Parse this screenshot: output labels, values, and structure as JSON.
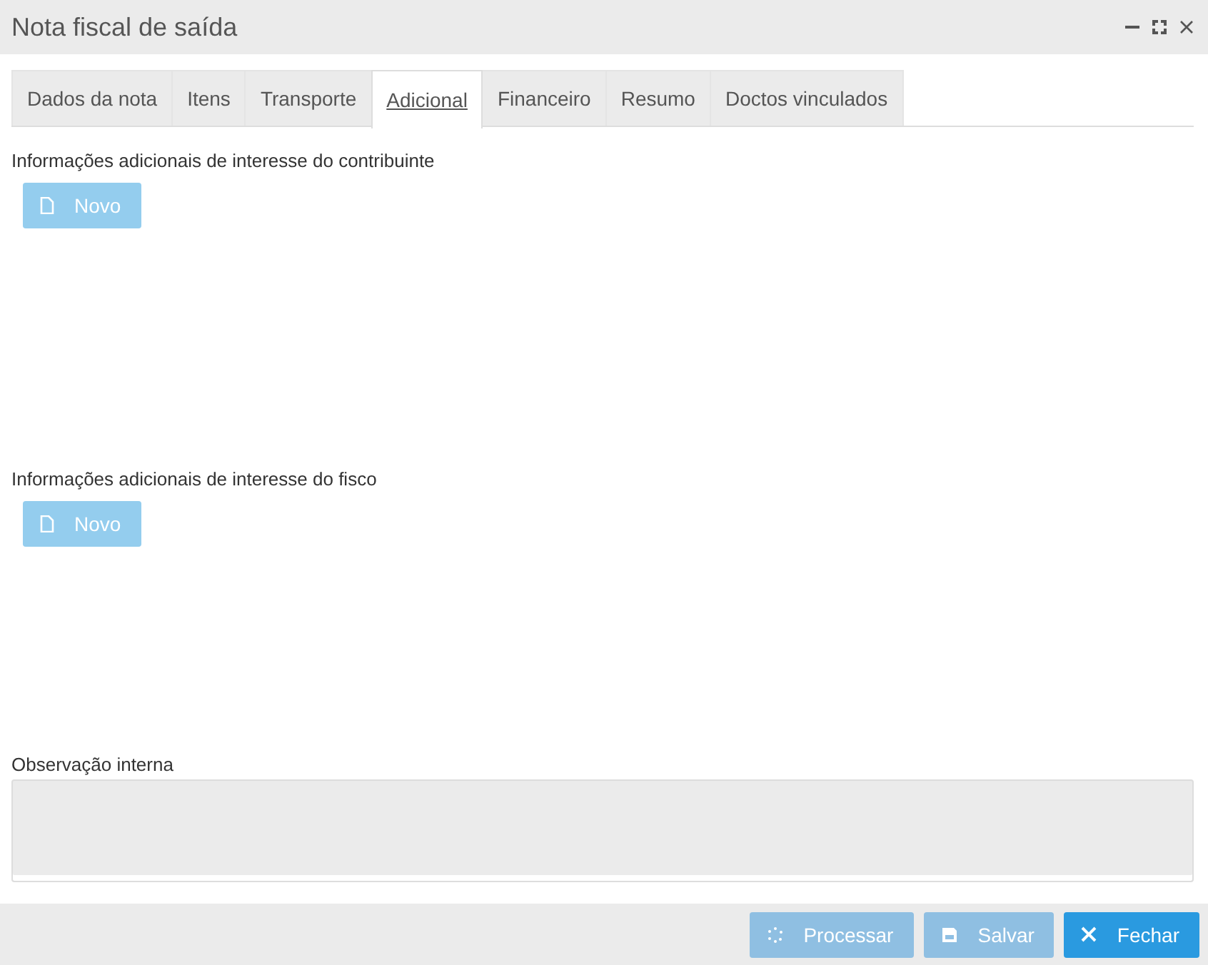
{
  "window": {
    "title": "Nota fiscal de saída"
  },
  "tabs": [
    {
      "label": "Dados da nota",
      "selected": false
    },
    {
      "label": "Itens",
      "selected": false
    },
    {
      "label": "Transporte",
      "selected": false
    },
    {
      "label": "Adicional",
      "selected": true
    },
    {
      "label": "Financeiro",
      "selected": false
    },
    {
      "label": "Resumo",
      "selected": false
    },
    {
      "label": "Doctos vinculados",
      "selected": false
    }
  ],
  "sections": [
    {
      "label": "Informações adicionais de interesse do contribuinte",
      "button": {
        "label": "Novo",
        "disabled": true
      }
    },
    {
      "label": "Informações adicionais de interesse do fisco",
      "button": {
        "label": "Novo",
        "disabled": true
      }
    }
  ],
  "internal_note": {
    "label": "Observação interna",
    "disabled": true
  },
  "footer_buttons": [
    {
      "kind": "process",
      "label": "Processar",
      "disabled": true
    },
    {
      "kind": "save",
      "label": "Salvar",
      "disabled": true
    },
    {
      "kind": "close",
      "label": "Fechar",
      "disabled": false
    }
  ]
}
